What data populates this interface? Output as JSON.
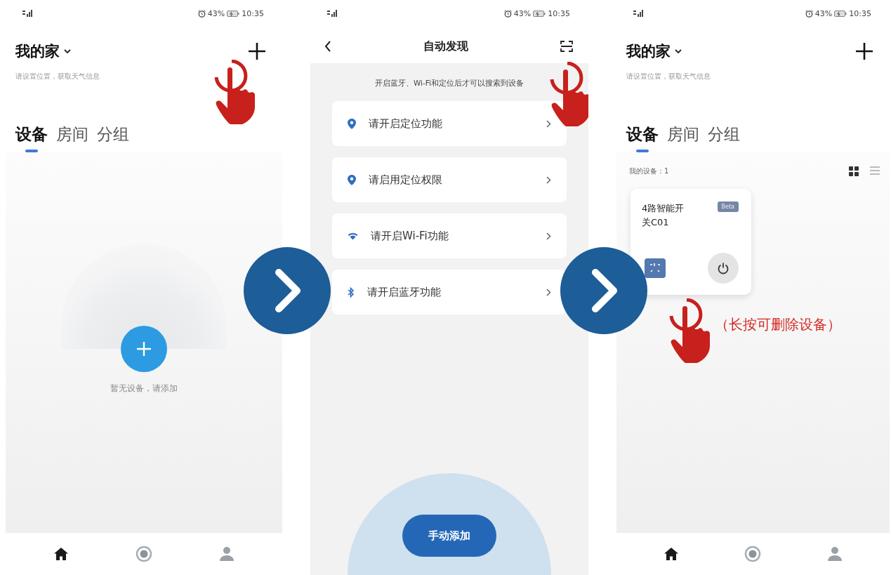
{
  "screens": [
    {
      "kind": "home",
      "status_bar": {
        "battery": "43%",
        "time": "10:35"
      },
      "home_name": "我的家",
      "location_hint": "请设置位置，获取天气信息",
      "tabs": [
        {
          "label": "设备",
          "selected": true
        },
        {
          "label": "房间",
          "selected": false
        },
        {
          "label": "分组",
          "selected": false
        }
      ],
      "empty_text": "暂无设备，请添加",
      "nav_items": [
        {
          "selected": true
        },
        {
          "selected": false
        },
        {
          "selected": false
        }
      ]
    },
    {
      "kind": "discover",
      "status_bar": {
        "battery": "43%",
        "time": "10:35"
      },
      "title": "自动发现",
      "notice": "开启蓝牙、Wi-Fi和定位后才可以搜索到设备",
      "items": [
        {
          "kind": "location",
          "label": "请开启定位功能"
        },
        {
          "kind": "location",
          "label": "请启用定位权限"
        },
        {
          "kind": "wifi",
          "label": "请开启Wi-Fi功能"
        },
        {
          "kind": "bluetooth",
          "label": "请开启蓝牙功能"
        }
      ],
      "button": "手动添加"
    },
    {
      "kind": "home",
      "status_bar": {
        "battery": "43%",
        "time": "10:35"
      },
      "home_name": "我的家",
      "location_hint": "请设置位置，获取天气信息",
      "tabs": [
        {
          "label": "设备",
          "selected": true
        },
        {
          "label": "房间",
          "selected": false
        },
        {
          "label": "分组",
          "selected": false
        }
      ],
      "device_count": "我的设备：1",
      "views": [
        {
          "selected": true
        },
        {
          "selected": false
        }
      ],
      "devices": [
        {
          "name": "4路智能开关C01",
          "badge": "Beta"
        }
      ],
      "nav_items": [
        {
          "selected": true
        },
        {
          "selected": false
        },
        {
          "selected": false
        }
      ],
      "note": "（长按可删除设备）"
    }
  ]
}
